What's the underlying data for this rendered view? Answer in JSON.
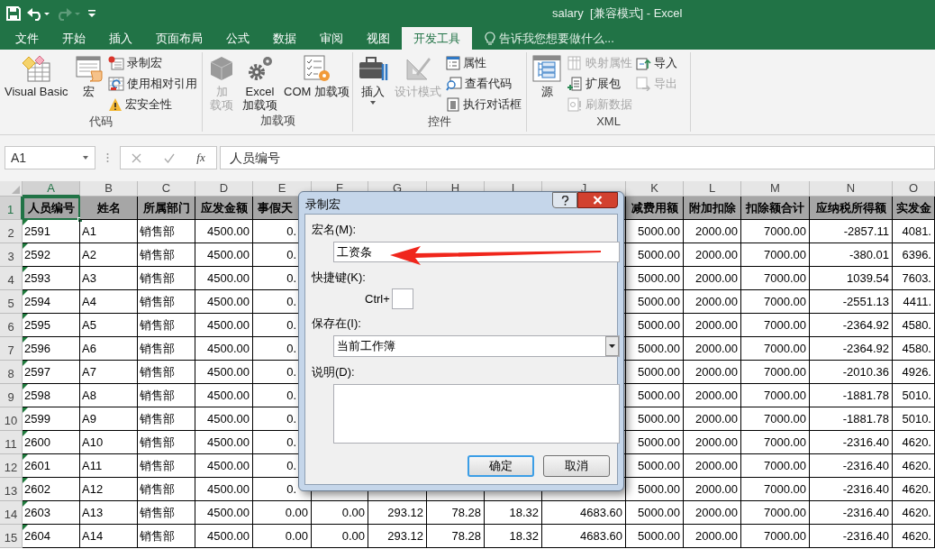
{
  "quick_access": [
    {
      "kind": "save",
      "disabled": false
    },
    {
      "kind": "undo",
      "disabled": false
    },
    {
      "kind": "redo",
      "disabled": true
    },
    {
      "kind": "customize",
      "disabled": false
    }
  ],
  "window": {
    "title": "salary  [兼容模式] - Excel"
  },
  "tabs": [
    {
      "label": "文件",
      "selected": false
    },
    {
      "label": "开始",
      "selected": false
    },
    {
      "label": "插入",
      "selected": false
    },
    {
      "label": "页面布局",
      "selected": false
    },
    {
      "label": "公式",
      "selected": false
    },
    {
      "label": "数据",
      "selected": false
    },
    {
      "label": "审阅",
      "selected": false
    },
    {
      "label": "视图",
      "selected": false
    },
    {
      "label": "开发工具",
      "selected": true
    }
  ],
  "tell_me": {
    "placeholder": "告诉我您想要做什么..."
  },
  "ribbon_groups": [
    {
      "label": "代码",
      "columns": [
        [
          {
            "kind": "large",
            "lines": [
              "Visual Basic"
            ],
            "disabled": false
          }
        ],
        [
          {
            "kind": "large",
            "lines": [
              "宏"
            ],
            "disabled": false
          }
        ],
        [
          {
            "kind": "small",
            "lines": [
              "录制宏"
            ],
            "disabled": false
          },
          {
            "kind": "small",
            "lines": [
              "使用相对引用"
            ],
            "disabled": false
          },
          {
            "kind": "small",
            "lines": [
              "宏安全性"
            ],
            "disabled": false
          }
        ]
      ]
    },
    {
      "label": "加载项",
      "columns": [
        [
          {
            "kind": "large",
            "lines": [
              "加",
              "载项"
            ],
            "disabled": true
          }
        ],
        [
          {
            "kind": "large",
            "lines": [
              "Excel",
              "加载项"
            ],
            "disabled": false
          }
        ],
        [
          {
            "kind": "large",
            "lines": [
              "COM 加载项"
            ],
            "disabled": false
          }
        ]
      ]
    },
    {
      "label": "控件",
      "columns": [
        [
          {
            "kind": "large",
            "lines": [
              "插入"
            ],
            "disabled": false,
            "dropdown": true
          }
        ],
        [
          {
            "kind": "large",
            "lines": [
              "设计模式"
            ],
            "disabled": true
          }
        ],
        [
          {
            "kind": "small",
            "lines": [
              "属性"
            ],
            "disabled": false
          },
          {
            "kind": "small",
            "lines": [
              "查看代码"
            ],
            "disabled": false
          },
          {
            "kind": "small",
            "lines": [
              "执行对话框"
            ],
            "disabled": false
          }
        ]
      ]
    },
    {
      "label": "XML",
      "columns": [
        [
          {
            "kind": "large",
            "lines": [
              "源"
            ],
            "disabled": false
          }
        ],
        [
          {
            "kind": "small",
            "lines": [
              "映射属性"
            ],
            "disabled": true
          },
          {
            "kind": "small",
            "lines": [
              "扩展包"
            ],
            "disabled": false
          },
          {
            "kind": "small",
            "lines": [
              "刷新数据"
            ],
            "disabled": true
          }
        ],
        [
          {
            "kind": "small",
            "lines": [
              "导入"
            ],
            "disabled": false
          },
          {
            "kind": "small",
            "lines": [
              "导出"
            ],
            "disabled": true
          }
        ]
      ]
    }
  ],
  "name_box": {
    "value": "A1"
  },
  "formula_bar": {
    "function_label": "fx",
    "value": "人员编号"
  },
  "columns": [
    {
      "letter": "A",
      "selected": true
    },
    {
      "letter": "B",
      "selected": false
    },
    {
      "letter": "C",
      "selected": false
    },
    {
      "letter": "D",
      "selected": false
    },
    {
      "letter": "E",
      "selected": false
    },
    {
      "letter": "F",
      "selected": false
    },
    {
      "letter": "G",
      "selected": false
    },
    {
      "letter": "H",
      "selected": false
    },
    {
      "letter": "I",
      "selected": false
    },
    {
      "letter": "J",
      "selected": false
    },
    {
      "letter": "K",
      "selected": false
    },
    {
      "letter": "L",
      "selected": false
    },
    {
      "letter": "M",
      "selected": false
    },
    {
      "letter": "N",
      "selected": false
    },
    {
      "letter": "O",
      "selected": false
    }
  ],
  "rows": [
    {
      "number": "1",
      "kind": "header",
      "selected": true,
      "cells": {
        "A": "人员编号",
        "B": "姓名",
        "C": "所属部门",
        "D": "应发金额",
        "E": "事假天",
        "K": "减费用额",
        "L": "附加扣除",
        "M": "扣除额合计",
        "N": "应纳税所得额",
        "O": "实发金"
      }
    },
    {
      "number": "2",
      "kind": "data",
      "selected": false,
      "cells": {
        "A": "2591",
        "B": "A1",
        "C": "销售部",
        "D": "4500.00",
        "E": "0.",
        "K": "5000.00",
        "L": "2000.00",
        "M": "7000.00",
        "N": "-2857.11",
        "O": "4081."
      }
    },
    {
      "number": "3",
      "kind": "data",
      "selected": false,
      "cells": {
        "A": "2592",
        "B": "A2",
        "C": "销售部",
        "D": "4500.00",
        "E": "0.",
        "K": "5000.00",
        "L": "2000.00",
        "M": "7000.00",
        "N": "-380.01",
        "O": "6396."
      }
    },
    {
      "number": "4",
      "kind": "data",
      "selected": false,
      "cells": {
        "A": "2593",
        "B": "A3",
        "C": "销售部",
        "D": "4500.00",
        "E": "0.",
        "K": "5000.00",
        "L": "2000.00",
        "M": "7000.00",
        "N": "1039.54",
        "O": "7603."
      }
    },
    {
      "number": "5",
      "kind": "data",
      "selected": false,
      "cells": {
        "A": "2594",
        "B": "A4",
        "C": "销售部",
        "D": "4500.00",
        "E": "0.",
        "K": "5000.00",
        "L": "2000.00",
        "M": "7000.00",
        "N": "-2551.13",
        "O": "4411."
      }
    },
    {
      "number": "6",
      "kind": "data",
      "selected": false,
      "cells": {
        "A": "2595",
        "B": "A5",
        "C": "销售部",
        "D": "4500.00",
        "E": "0.",
        "K": "5000.00",
        "L": "2000.00",
        "M": "7000.00",
        "N": "-2364.92",
        "O": "4580."
      }
    },
    {
      "number": "7",
      "kind": "data",
      "selected": false,
      "cells": {
        "A": "2596",
        "B": "A6",
        "C": "销售部",
        "D": "4500.00",
        "E": "0.",
        "K": "5000.00",
        "L": "2000.00",
        "M": "7000.00",
        "N": "-2364.92",
        "O": "4580."
      }
    },
    {
      "number": "8",
      "kind": "data",
      "selected": false,
      "cells": {
        "A": "2597",
        "B": "A7",
        "C": "销售部",
        "D": "4500.00",
        "E": "0.",
        "K": "5000.00",
        "L": "2000.00",
        "M": "7000.00",
        "N": "-2010.36",
        "O": "4926."
      }
    },
    {
      "number": "9",
      "kind": "data",
      "selected": false,
      "cells": {
        "A": "2598",
        "B": "A8",
        "C": "销售部",
        "D": "4500.00",
        "E": "0.",
        "K": "5000.00",
        "L": "2000.00",
        "M": "7000.00",
        "N": "-1881.78",
        "O": "5010."
      }
    },
    {
      "number": "10",
      "kind": "data",
      "selected": false,
      "cells": {
        "A": "2599",
        "B": "A9",
        "C": "销售部",
        "D": "4500.00",
        "E": "0.",
        "K": "5000.00",
        "L": "2000.00",
        "M": "7000.00",
        "N": "-1881.78",
        "O": "5010."
      }
    },
    {
      "number": "11",
      "kind": "data",
      "selected": false,
      "cells": {
        "A": "2600",
        "B": "A10",
        "C": "销售部",
        "D": "4500.00",
        "E": "0.",
        "K": "5000.00",
        "L": "2000.00",
        "M": "7000.00",
        "N": "-2316.40",
        "O": "4620."
      }
    },
    {
      "number": "12",
      "kind": "data",
      "selected": false,
      "cells": {
        "A": "2601",
        "B": "A11",
        "C": "销售部",
        "D": "4500.00",
        "E": "0.",
        "K": "5000.00",
        "L": "2000.00",
        "M": "7000.00",
        "N": "-2316.40",
        "O": "4620."
      }
    },
    {
      "number": "13",
      "kind": "data",
      "selected": false,
      "cells": {
        "A": "2602",
        "B": "A12",
        "C": "销售部",
        "D": "4500.00",
        "E": "0.",
        "K": "5000.00",
        "L": "2000.00",
        "M": "7000.00",
        "N": "-2316.40",
        "O": "4620."
      }
    },
    {
      "number": "14",
      "kind": "data",
      "selected": false,
      "cells": {
        "A": "2603",
        "B": "A13",
        "C": "销售部",
        "D": "4500.00",
        "E": "0.00",
        "F": "0.00",
        "G": "293.12",
        "H": "78.28",
        "I": "18.32",
        "J": "4683.60",
        "K": "5000.00",
        "L": "2000.00",
        "M": "7000.00",
        "N": "-2316.40",
        "O": "4620."
      }
    },
    {
      "number": "15",
      "kind": "data",
      "selected": false,
      "cells": {
        "A": "2604",
        "B": "A14",
        "C": "销售部",
        "D": "4500.00",
        "E": "0.00",
        "F": "0.00",
        "G": "293.12",
        "H": "78.28",
        "I": "18.32",
        "J": "4683.60",
        "K": "5000.00",
        "L": "2000.00",
        "M": "7000.00",
        "N": "-2316.40",
        "O": "4620."
      }
    }
  ],
  "dialog": {
    "title": "录制宏",
    "fields": [
      {
        "kind": "text",
        "label": "宏名(M):",
        "value": "工资条"
      },
      {
        "kind": "shortcut",
        "label": "快捷键(K):",
        "prefix": "Ctrl+"
      },
      {
        "kind": "select",
        "label": "保存在(I):",
        "value": "当前工作簿"
      },
      {
        "kind": "textarea",
        "label": "说明(D):"
      }
    ],
    "buttons": [
      {
        "label": "确定",
        "default": true
      },
      {
        "label": "取消",
        "default": false
      }
    ]
  }
}
